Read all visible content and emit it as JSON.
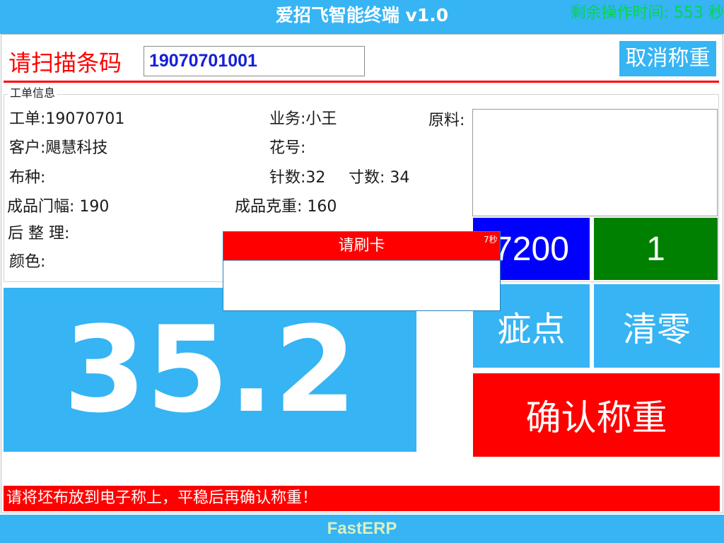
{
  "header": {
    "title": "爱招飞智能终端 v1.0",
    "timer_text": "剩余操作时间: 553 秒"
  },
  "scan": {
    "label": "请扫描条码",
    "barcode_value": "19070701001",
    "cancel_label": "取消称重"
  },
  "work_order": {
    "group_title": "工单信息",
    "order_label": "工单:",
    "order_value": "19070701",
    "salesman_label": "业务:",
    "salesman_value": "小王",
    "material_label": "原料:",
    "customer_label": "客户:",
    "customer_value": "飓慧科技",
    "pattern_label": "花号:",
    "pattern_value": "",
    "fabric_label": "布种:",
    "fabric_value": "",
    "needle_label": "针数:",
    "needle_value": "32",
    "inch_label": "寸数:",
    "inch_value": "34",
    "width_label": "成品门幅:",
    "width_value": "190",
    "gsm_label": "成品克重:",
    "gsm_value": "160",
    "finishing_label": "后 整 理:",
    "finishing_value": "",
    "color_label": "颜色:",
    "color_value": ""
  },
  "tiles": {
    "blue_value": "7200",
    "green_value": "1",
    "defect_label": "疵点",
    "clear_label": "清零",
    "confirm_label": "确认称重"
  },
  "weight": {
    "value": "35.2"
  },
  "dialog": {
    "title": "请刷卡",
    "countdown": "7秒"
  },
  "message": "请将坯布放到电子称上，平稳后再确认称重！",
  "footer": "FastERP",
  "colors": {
    "brand_blue": "#36b4f4",
    "alert_red": "#ff0000",
    "timer_green": "#00d84a",
    "tile_blue": "#0000ff",
    "tile_green": "#008000"
  }
}
